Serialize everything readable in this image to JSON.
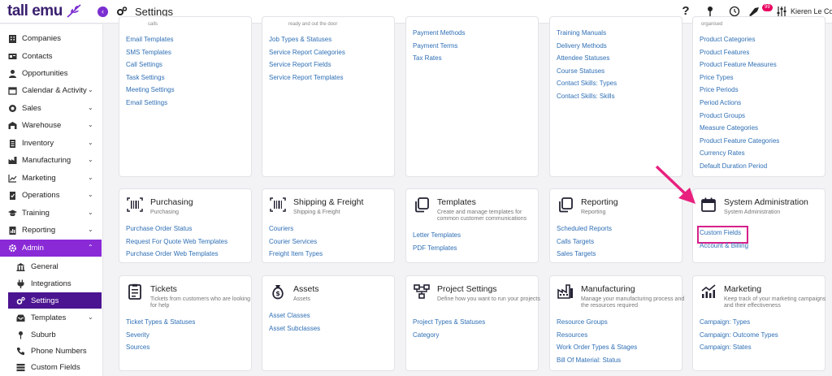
{
  "topbar": {
    "logo_text": "tall emu",
    "page_title": "Settings",
    "help_label": "?",
    "notification_count": "99",
    "user_name": "Kieren Le Cornu"
  },
  "sidebar": {
    "items": [
      {
        "label": "Companies",
        "icon": "building-icon"
      },
      {
        "label": "Contacts",
        "icon": "id-card-icon"
      },
      {
        "label": "Opportunities",
        "icon": "user-icon"
      },
      {
        "label": "Calendar & Activity",
        "icon": "calendar-icon"
      },
      {
        "label": "Sales",
        "icon": "coin-icon"
      },
      {
        "label": "Warehouse",
        "icon": "warehouse-icon"
      },
      {
        "label": "Inventory",
        "icon": "clipboard-icon"
      },
      {
        "label": "Manufacturing",
        "icon": "factory-icon"
      },
      {
        "label": "Marketing",
        "icon": "chart-icon"
      },
      {
        "label": "Operations",
        "icon": "clipboard-check-icon"
      },
      {
        "label": "Training",
        "icon": "graduation-cap-icon"
      },
      {
        "label": "Reporting",
        "icon": "report-icon"
      },
      {
        "label": "Admin",
        "icon": "gear-icon"
      }
    ],
    "sub_items": [
      {
        "label": "General",
        "icon": "building-columns-icon"
      },
      {
        "label": "Integrations",
        "icon": "plug-icon"
      },
      {
        "label": "Settings",
        "icon": "gears-icon"
      },
      {
        "label": "Templates",
        "icon": "inbox-icon"
      },
      {
        "label": "Suburb",
        "icon": "map-pin-icon"
      },
      {
        "label": "Phone Numbers",
        "icon": "phone-icon"
      },
      {
        "label": "Custom Fields",
        "icon": "list-icon"
      }
    ],
    "chevron": "⌄",
    "chevron_up": "⌃"
  },
  "cards_top": [
    {
      "toptext": "calls",
      "links": [
        "Email Templates",
        "SMS Templates",
        "Call Settings",
        "Task Settings",
        "Meeting Settings",
        "Email Settings"
      ]
    },
    {
      "toptext": "ready and out the door",
      "links": [
        "Job Types & Statuses",
        "Service Report Categories",
        "Service Report Fields",
        "Service Report Templates"
      ]
    },
    {
      "toptext": "",
      "links": [
        "Payment Methods",
        "Payment Terms",
        "Tax Rates"
      ]
    },
    {
      "toptext": "",
      "links": [
        "Training Manuals",
        "Delivery Methods",
        "Attendee Statuses",
        "Course Statuses",
        "Contact Skills: Types",
        "Contact Skills: Skills"
      ]
    },
    {
      "toptext": "organised",
      "links": [
        "Product Categories",
        "Product Features",
        "Product Feature Measures",
        "Price Types",
        "Price Periods",
        "Period Actions",
        "Product Groups",
        "Measure Categories",
        "Product Feature Categories",
        "Currency Rates",
        "Default Duration Period"
      ]
    }
  ],
  "cards_mid": [
    {
      "title": "Purchasing",
      "sub": "Purchasing",
      "links": [
        "Purchase Order Status",
        "Request For Quote Web Templates",
        "Purchase Order Web Templates"
      ]
    },
    {
      "title": "Shipping & Freight",
      "sub": "Shipping & Freight",
      "links": [
        "Couriers",
        "Courier Services",
        "Freight Item Types"
      ]
    },
    {
      "title": "Templates",
      "sub": "Create and manage templates for common customer communications",
      "links": [
        "Letter Templates",
        "PDF Templates"
      ]
    },
    {
      "title": "Reporting",
      "sub": "Reporting",
      "links": [
        "Scheduled Reports",
        "Calls Targets",
        "Sales Targets"
      ]
    },
    {
      "title": "System Administration",
      "sub": "System Administration",
      "links": [
        "Custom Fields",
        "Account & Billing"
      ]
    }
  ],
  "cards_bot": [
    {
      "title": "Tickets",
      "sub": "Tickets from customers who are looking for help",
      "links": [
        "Ticket Types & Statuses",
        "Severity",
        "Sources"
      ]
    },
    {
      "title": "Assets",
      "sub": "Assets",
      "links": [
        "Asset Classes",
        "Asset Subclasses"
      ]
    },
    {
      "title": "Project Settings",
      "sub": "Define how you want to run your projects",
      "links": [
        "Project Types & Statuses",
        "Category"
      ]
    },
    {
      "title": "Manufacturing",
      "sub": "Manage your manufacturing process and the resources required",
      "links": [
        "Resource Groups",
        "Resources",
        "Work Order Types & Stages",
        "Bill Of Material: Status"
      ]
    },
    {
      "title": "Marketing",
      "sub": "Keep track of your marketing campaigns and their effectiveness",
      "links": [
        "Campaign: Types",
        "Campaign: Outcome Types",
        "Campaign: States"
      ]
    }
  ],
  "colors": {
    "accent": "#8a2ad6",
    "accent_dark": "#4b1490",
    "link": "#2f6fb5",
    "highlight": "#d6218a"
  }
}
